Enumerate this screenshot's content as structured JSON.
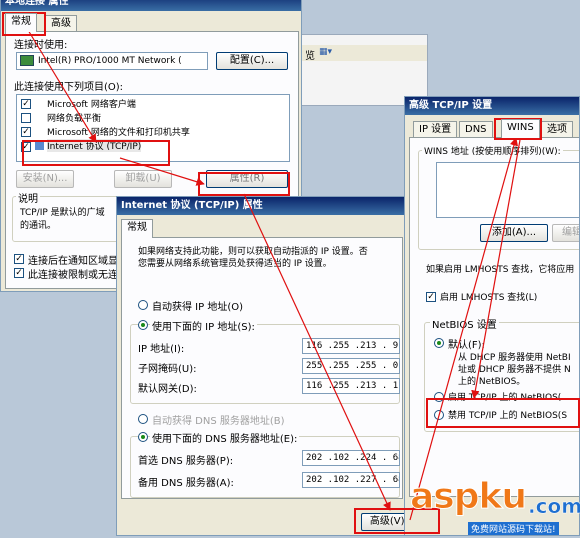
{
  "window1": {
    "title": "本地连接 属性",
    "tabs": [
      "常规",
      "高级"
    ],
    "connect_using_label": "连接时使用:",
    "adapter": "Intel(R) PRO/1000 MT Network (",
    "configure_button": "配置(C)...",
    "items_label": "此连接使用下列项目(O):",
    "items": [
      {
        "label": "Microsoft 网络客户端",
        "checked": true
      },
      {
        "label": "网络负载平衡",
        "checked": false
      },
      {
        "label": "Microsoft 网络的文件和打印机共享",
        "checked": true
      },
      {
        "label": "Internet 协议 (TCP/IP)",
        "checked": true
      }
    ],
    "install_button": "安装(N)...",
    "uninstall_button": "卸载(U)",
    "properties_button": "属性(R)",
    "desc_title": "说明",
    "desc_text_1": "TCP/IP 是默认的广域",
    "desc_text_2": "的通讯。",
    "notify_checkbox": "连接后在通知区域显",
    "limited_checkbox": "此连接被限制或无连"
  },
  "background": {
    "fragment": "览"
  },
  "window2": {
    "title": "Internet 协议 (TCP/IP) 属性",
    "tab": "常规",
    "intro_1": "如果网络支持此功能，则可以获取自动指派的 IP 设置。否",
    "intro_2": "您需要从网络系统管理员处获得适当的 IP 设置。",
    "auto_ip": "自动获得 IP 地址(O)",
    "use_ip": "使用下面的 IP 地址(S):",
    "ip_label": "IP 地址(I):",
    "ip_value": "116 .255 .213 . 91",
    "mask_label": "子网掩码(U):",
    "mask_value": "255 .255 .255 . 0",
    "gateway_label": "默认网关(D):",
    "gateway_value": "116 .255 .213 . 1",
    "auto_dns": "自动获得 DNS 服务器地址(B)",
    "use_dns": "使用下面的 DNS 服务器地址(E):",
    "dns1_label": "首选 DNS 服务器(P):",
    "dns1_value": "202 .102 .224 . 68",
    "dns2_label": "备用 DNS 服务器(A):",
    "dns2_value": "202 .102 .227 . 68",
    "advanced_button": "高级(V)..."
  },
  "window3": {
    "title": "高级 TCP/IP 设置",
    "tabs": [
      "IP 设置",
      "DNS",
      "WINS",
      "选项"
    ],
    "wins_list_label": "WINS 地址 (按使用顺序排列)(W):",
    "add_button": "添加(A)...",
    "edit_button": "编辑",
    "lmhosts_hint": "如果启用 LMHOSTS 查找，它将应用",
    "lmhosts_checkbox": "启用 LMHOSTS 查找(L)",
    "netbios_title": "NetBIOS 设置",
    "netbios_default": "默认(F):",
    "netbios_default_desc_1": "从 DHCP 服务器使用 NetBI",
    "netbios_default_desc_2": "址或 DHCP 服务器不提供 N",
    "netbios_default_desc_3": "上的 NetBIOS。",
    "netbios_enable": "启用 TCP/IP 上的 NetBIOS(",
    "netbios_disable": "禁用 TCP/IP 上的 NetBIOS(S"
  },
  "watermark": {
    "brand": "aspku",
    "tld": ".com",
    "tagline": "免费网站源码下载站!"
  },
  "colors": {
    "highlight": "#e01010",
    "dialog_bg": "#ece9d8",
    "title_gradient_start": "#0a246a",
    "title_gradient_end": "#3a6ea5",
    "watermark_orange": "#f07818",
    "watermark_blue": "#1e6fd0"
  }
}
